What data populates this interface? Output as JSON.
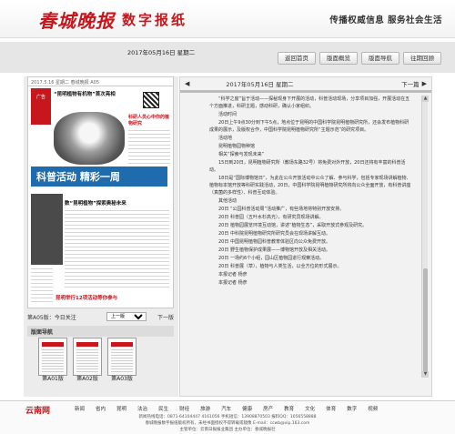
{
  "header": {
    "brand": "春城晚报",
    "brand_sub": "数字报纸",
    "slogan": "传播权威信息  服务社会生活"
  },
  "topbar": {
    "date": "2017年05月16日  星期二",
    "buttons": [
      "返回首页",
      "版面概览",
      "版面导航",
      "往期回顾"
    ]
  },
  "left": {
    "thumb": {
      "top_left": "2017.5.16  星期二  春城晚报 A05",
      "ad": "广告",
      "headline1": "“昆明植物有机物”首次亮相",
      "side_title": "科研人员心中你的植物研究",
      "banner": "科普活动  精彩一周",
      "headline2": "数“昆明植物”探索奥秘未来",
      "headline3": "昆明举行12项活动等你参与"
    },
    "pagebar": {
      "current": "第A05版：今日关注",
      "prev": "上一版",
      "next": "下一版"
    },
    "list_title": "版面导航",
    "pages": [
      "第A01版",
      "第A02版",
      "第A03版"
    ]
  },
  "right": {
    "date": "2017年05月16日  星期二",
    "next_label": "下一篇",
    "article": [
      "“科学之窗”旨于活动——探秘现身下开展的活动，科普活动现场，分享项目加强，开展活动在五个方面推进，科研主题，感动科研，确认小家组织。",
      "活动时间",
      "20日上午9点30分到下午5点，地点位于昆明的中国科学院昆明植物研究所，还会发布植物科研成果的展示，及版权合作，中国科学院昆明植物研究所“主题示范”的研究项目。",
      "活动地",
      "昆明植物园物种馆",
      "相关“探索与发现未来”",
      "15日到20日，昆明植物研究所（教场东路32号）将免费对外开放，20日还将有丰富的科普活动。",
      "18日是“国际博物馆日”，为此在公众开放活动中公众了解、参与科学，包括专家现场讲解植物、植物标本馆开放等科研实践活动，20日，中国科学院昆明植物研究所将向公众全面开放，有科普讲座（真菌的多样性）、科普互动体验。",
      "其他活动",
      "20日  “公园科普活动周”活动推广，有些场地将特别开放安排。",
      "20日  科普园（五叶水杉高光），有研究员现场讲解。",
      "20日  植物园展览环境互动馆，讲述“植物生态”，采取开放式参观及研究。",
      "20日  中科院昆明植物研究所研究员会在现场讲解互动。",
      "20日  中国昆明植物园科普教育体验区向公众免费开放。",
      "20日  野生植物保护成果展——博物馆开放及相关活动。",
      "20日  一场约6个小组，园山区植物园进行观察活动。",
      "20日  科普展（草），植物与人类生活，以全方位的形式展示。",
      "本报记者  杨彦",
      "",
      "本报记者  杨彦"
    ]
  },
  "footer": {
    "logo": "云南网",
    "nav": [
      "新闻",
      "省内",
      "昆明",
      "法治",
      "民生",
      "财经",
      "旅游",
      "汽车",
      "健康",
      "房产",
      "教育",
      "文化",
      "体育",
      "数字",
      "视频"
    ],
    "line1": "新闻热线电话：0871-64104447  4161056  手机短信：13908870503  报料QQ：1056558888",
    "line2": "春城晚报数字报纸版权所有，未经书面授权不得转载或镜像  E-mail：ccwb@vip.163.com",
    "line3": "主管单位：云南日报报业集团  主办单位：春城晚报社"
  }
}
